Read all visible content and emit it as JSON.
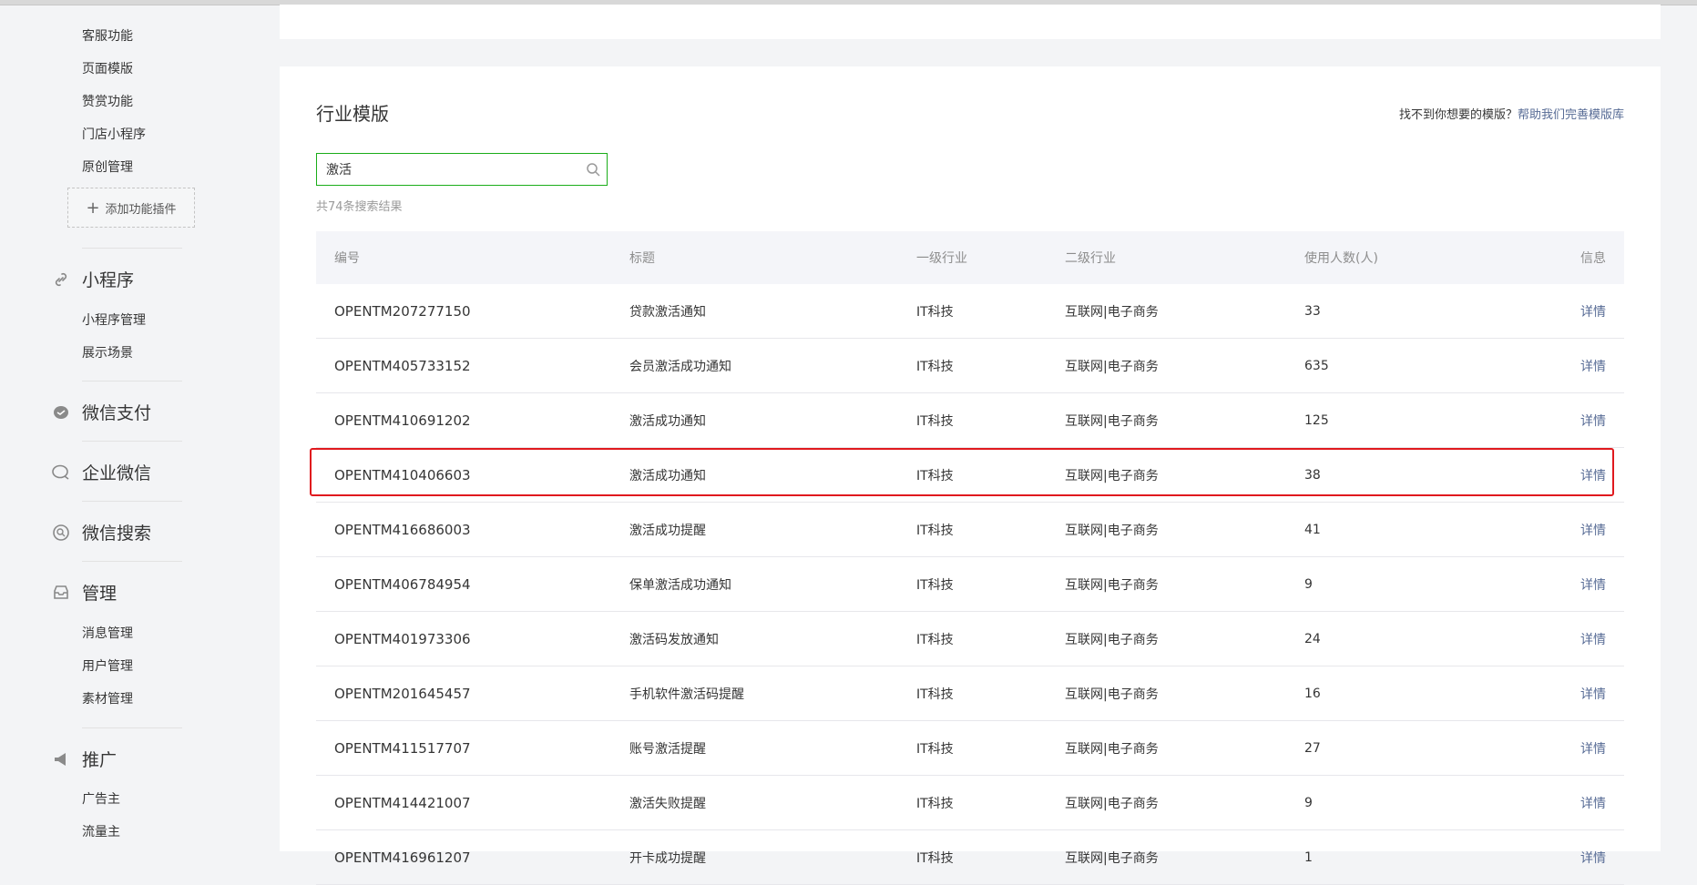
{
  "sidebar": {
    "top_items": [
      "客服功能",
      "页面模版",
      "赞赏功能",
      "门店小程序",
      "原创管理"
    ],
    "add_plugin_label": "添加功能插件",
    "sections": [
      {
        "title": "小程序",
        "icon": "link-icon",
        "items": [
          "小程序管理",
          "展示场景"
        ]
      },
      {
        "title": "微信支付",
        "icon": "wechat-pay-icon",
        "items": []
      },
      {
        "title": "企业微信",
        "icon": "chat-bubble-icon",
        "items": []
      },
      {
        "title": "微信搜索",
        "icon": "search-circle-icon",
        "items": []
      },
      {
        "title": "管理",
        "icon": "inbox-icon",
        "items": [
          "消息管理",
          "用户管理",
          "素材管理"
        ]
      },
      {
        "title": "推广",
        "icon": "megaphone-icon",
        "items": [
          "广告主",
          "流量主"
        ]
      }
    ]
  },
  "main": {
    "title": "行业模版",
    "help_text": "找不到你想要的模版？",
    "help_link": "帮助我们完善模版库",
    "search": {
      "value": "激活",
      "placeholder": ""
    },
    "result_count": "共74条搜索结果",
    "columns": [
      "编号",
      "标题",
      "一级行业",
      "二级行业",
      "使用人数(人)",
      "信息"
    ],
    "rows": [
      {
        "id": "OPENTM207277150",
        "title": "贷款激活通知",
        "industry1": "IT科技",
        "industry2": "互联网|电子商务",
        "users": "33",
        "info": "详情"
      },
      {
        "id": "OPENTM405733152",
        "title": "会员激活成功通知",
        "industry1": "IT科技",
        "industry2": "互联网|电子商务",
        "users": "635",
        "info": "详情"
      },
      {
        "id": "OPENTM410691202",
        "title": "激活成功通知",
        "industry1": "IT科技",
        "industry2": "互联网|电子商务",
        "users": "125",
        "info": "详情"
      },
      {
        "id": "OPENTM410406603",
        "title": "激活成功通知",
        "industry1": "IT科技",
        "industry2": "互联网|电子商务",
        "users": "38",
        "info": "详情"
      },
      {
        "id": "OPENTM416686003",
        "title": "激活成功提醒",
        "industry1": "IT科技",
        "industry2": "互联网|电子商务",
        "users": "41",
        "info": "详情"
      },
      {
        "id": "OPENTM406784954",
        "title": "保单激活成功通知",
        "industry1": "IT科技",
        "industry2": "互联网|电子商务",
        "users": "9",
        "info": "详情"
      },
      {
        "id": "OPENTM401973306",
        "title": "激活码发放通知",
        "industry1": "IT科技",
        "industry2": "互联网|电子商务",
        "users": "24",
        "info": "详情"
      },
      {
        "id": "OPENTM201645457",
        "title": "手机软件激活码提醒",
        "industry1": "IT科技",
        "industry2": "互联网|电子商务",
        "users": "16",
        "info": "详情"
      },
      {
        "id": "OPENTM411517707",
        "title": "账号激活提醒",
        "industry1": "IT科技",
        "industry2": "互联网|电子商务",
        "users": "27",
        "info": "详情"
      },
      {
        "id": "OPENTM414421007",
        "title": "激活失败提醒",
        "industry1": "IT科技",
        "industry2": "互联网|电子商务",
        "users": "9",
        "info": "详情"
      },
      {
        "id": "OPENTM416961207",
        "title": "开卡成功提醒",
        "industry1": "IT科技",
        "industry2": "互联网|电子商务",
        "users": "1",
        "info": "详情"
      }
    ],
    "highlight_color": "#e0191e"
  }
}
